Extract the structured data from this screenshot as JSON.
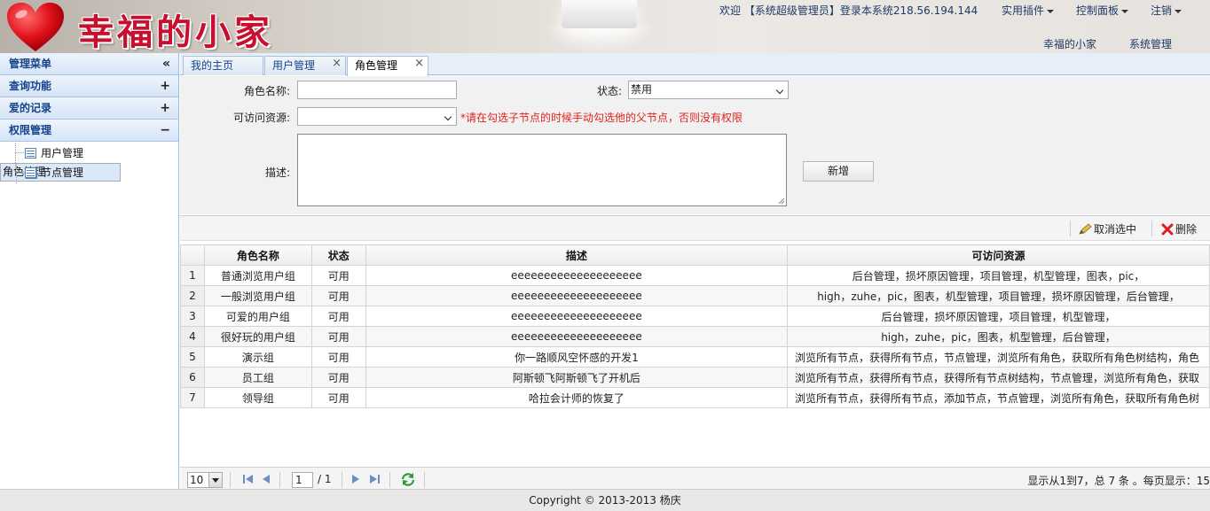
{
  "header": {
    "logo_text": "幸福的小家",
    "welcome_text": "欢迎 【系统超级管理员】登录本系统218.56.194.144",
    "menu": [
      "实用插件",
      "控制面板",
      "注销"
    ],
    "sub_links": [
      "幸福的小家",
      "系统管理"
    ]
  },
  "sidebar": {
    "title": "管理菜单",
    "panels": [
      {
        "label": "查询功能",
        "toggle": "+"
      },
      {
        "label": "爱的记录",
        "toggle": "+"
      },
      {
        "label": "权限管理",
        "toggle": "−"
      }
    ],
    "items": [
      "用户管理",
      "角色管理",
      "节点管理"
    ],
    "selected_item": "角色管理"
  },
  "tabs": [
    {
      "label": "我的主页"
    },
    {
      "label": "用户管理"
    },
    {
      "label": "角色管理",
      "active": true
    }
  ],
  "form": {
    "role_name_label": "角色名称:",
    "role_name_value": "",
    "status_label": "状态:",
    "status_value": "禁用",
    "resources_label": "可访问资源:",
    "resources_value": "",
    "hint": "*请在勾选子节点的时候手动勾选他的父节点，否则没有权限",
    "desc_label": "描述:",
    "add_button": "新增"
  },
  "grid": {
    "toolbar": {
      "deselect": "取消选中",
      "delete": "删除"
    },
    "columns": [
      "角色名称",
      "状态",
      "描述",
      "可访问资源"
    ],
    "rows": [
      {
        "n": "1",
        "name": "普通浏览用户组",
        "status": "可用",
        "desc": "eeeeeeeeeeeeeeeeeeee",
        "res": "后台管理，损坏原因管理，项目管理，机型管理，图表，pic，"
      },
      {
        "n": "2",
        "name": "一般浏览用户组",
        "status": "可用",
        "desc": "eeeeeeeeeeeeeeeeeeee",
        "res": "high，zuhe，pic，图表，机型管理，项目管理，损坏原因管理，后台管理，"
      },
      {
        "n": "3",
        "name": "可爱的用户组",
        "status": "可用",
        "desc": "eeeeeeeeeeeeeeeeeeee",
        "res": "后台管理，损坏原因管理，项目管理，机型管理，"
      },
      {
        "n": "4",
        "name": "很好玩的用户组",
        "status": "可用",
        "desc": "eeeeeeeeeeeeeeeeeeee",
        "res": "high，zuhe，pic，图表，机型管理，后台管理，"
      },
      {
        "n": "5",
        "name": "演示组",
        "status": "可用",
        "desc": "你一路顺风空怀感的开发1",
        "res": "浏览所有节点，获得所有节点，节点管理，浏览所有角色，获取所有角色树结构，角色"
      },
      {
        "n": "6",
        "name": "员工组",
        "status": "可用",
        "desc": "阿斯顿飞阿斯顿飞了开机后",
        "res": "浏览所有节点，获得所有节点，获得所有节点树结构，节点管理，浏览所有角色，获取"
      },
      {
        "n": "7",
        "name": "领导组",
        "status": "可用",
        "desc": "哈拉会计师的恢复了",
        "res": "浏览所有节点，获得所有节点，添加节点，节点管理，浏览所有角色，获取所有角色树"
      }
    ]
  },
  "pager": {
    "page_size": "10",
    "page_input": "1",
    "page_total": "/ 1",
    "summary": "显示从1到7，总 7 条 。每页显示：15"
  },
  "footer": "Copyright © 2013-2013 杨庆",
  "colors": {
    "accent": "#15428b",
    "hint": "#e0241b",
    "logo": "#c8102e"
  }
}
